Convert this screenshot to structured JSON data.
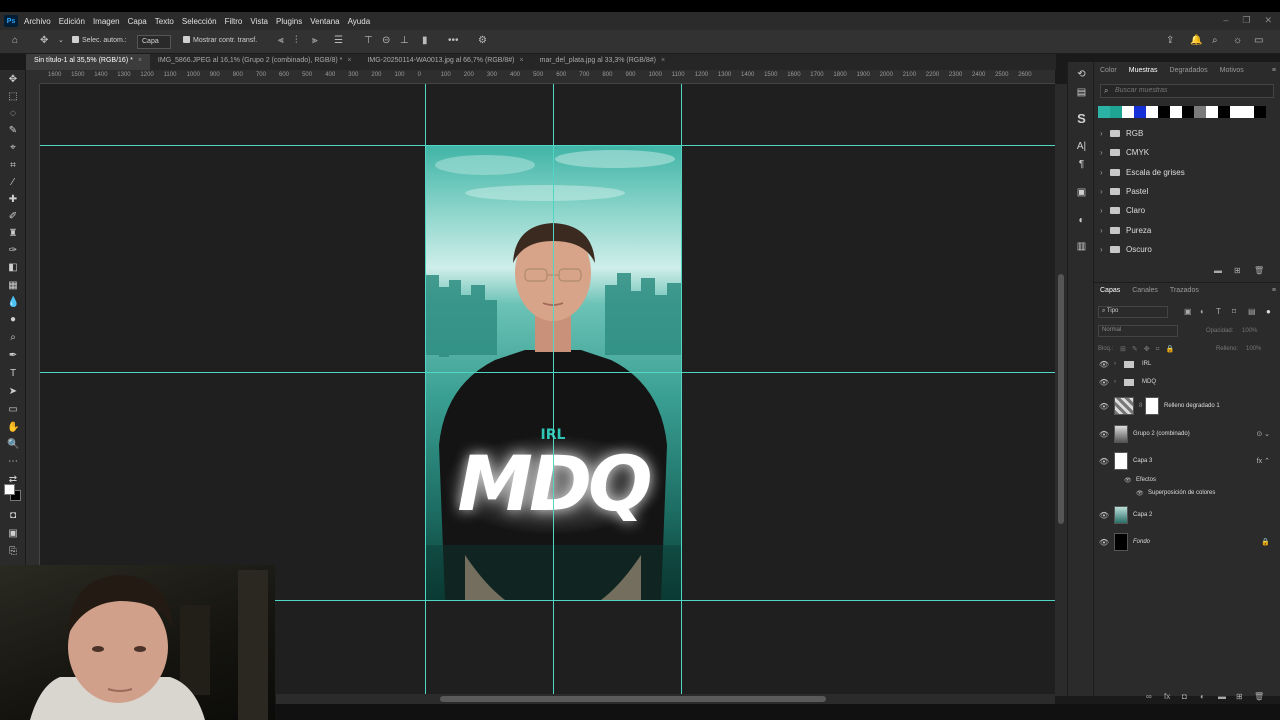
{
  "menubar": {
    "app_icon": "Ps",
    "items": [
      "Archivo",
      "Edición",
      "Imagen",
      "Capa",
      "Texto",
      "Selección",
      "Filtro",
      "Vista",
      "Plugins",
      "Ventana",
      "Ayuda"
    ]
  },
  "options": {
    "auto_select_label": "Selec. autom.:",
    "auto_select_value": "Capa",
    "show_transform_label": "Mostrar contr. transf.",
    "more": "•••"
  },
  "tabs": [
    {
      "label": "Sin título-1 al 35,5% (RGB/16) *",
      "active": true
    },
    {
      "label": "IMG_5866.JPEG al 16,1% (Grupo 2 (combinado), RGB/8) *",
      "active": false
    },
    {
      "label": "IMG-20250114-WA0013.jpg al 66,7% (RGB/8#)",
      "active": false
    },
    {
      "label": "mar_del_plata.jpg al 33,3% (RGB/8#)",
      "active": false
    }
  ],
  "ruler_labels": [
    "1600",
    "1500",
    "1400",
    "1300",
    "1200",
    "1100",
    "1000",
    "900",
    "800",
    "700",
    "600",
    "500",
    "400",
    "300",
    "200",
    "100",
    "0",
    "100",
    "200",
    "300",
    "400",
    "500",
    "600",
    "700",
    "800",
    "900",
    "1000",
    "1100",
    "1200",
    "1300",
    "1400",
    "1500",
    "1600",
    "1700",
    "1800",
    "1900",
    "2000",
    "2100",
    "2200",
    "2300",
    "2400",
    "2500",
    "2600"
  ],
  "artboard": {
    "small_title": "IRL",
    "big_title": "MDQ"
  },
  "swatches_panel": {
    "tabs": [
      "Color",
      "Muestras",
      "Degradados",
      "Motivos"
    ],
    "active_tab": "Muestras",
    "search_placeholder": "Buscar muestras",
    "colors": [
      "#2bb3a6",
      "#1fa392",
      "#ffffff",
      "#1530d6",
      "#ffffff",
      "#000000",
      "#ffffff",
      "#000000",
      "#7a7a7a",
      "#ffffff",
      "#000000",
      "#ffffff",
      "#ffffff",
      "#000000"
    ],
    "folders": [
      "RGB",
      "CMYK",
      "Escala de grises",
      "Pastel",
      "Claro",
      "Pureza",
      "Oscuro"
    ]
  },
  "layers_panel": {
    "tabs": [
      "Capas",
      "Canales",
      "Trazados"
    ],
    "active_tab": "Capas",
    "filter_value": "Tipo",
    "blend_mode": "Normal",
    "opacity_label": "Opacidad:",
    "opacity_value": "100%",
    "lock_label": "Bloq.:",
    "fill_label": "Relleno:",
    "fill_value": "100%",
    "layers": [
      {
        "name": "IRL",
        "kind": "folder",
        "right": ""
      },
      {
        "name": "MDQ",
        "kind": "folder",
        "right": ""
      },
      {
        "name": "Relleno degradado 1",
        "kind": "gradient",
        "right": ""
      },
      {
        "name": "Grupo 2 (combinado)",
        "kind": "photo",
        "right": "⊙ ⌄"
      },
      {
        "name": "Capa 3",
        "kind": "white",
        "right": "fx ⌃"
      },
      {
        "name": "Efectos",
        "kind": "effect-header",
        "right": ""
      },
      {
        "name": "Superposición de colores",
        "kind": "effect",
        "right": ""
      },
      {
        "name": "Capa 2",
        "kind": "photo2",
        "right": ""
      },
      {
        "name": "Fondo",
        "kind": "black",
        "right": "🔒"
      }
    ]
  }
}
